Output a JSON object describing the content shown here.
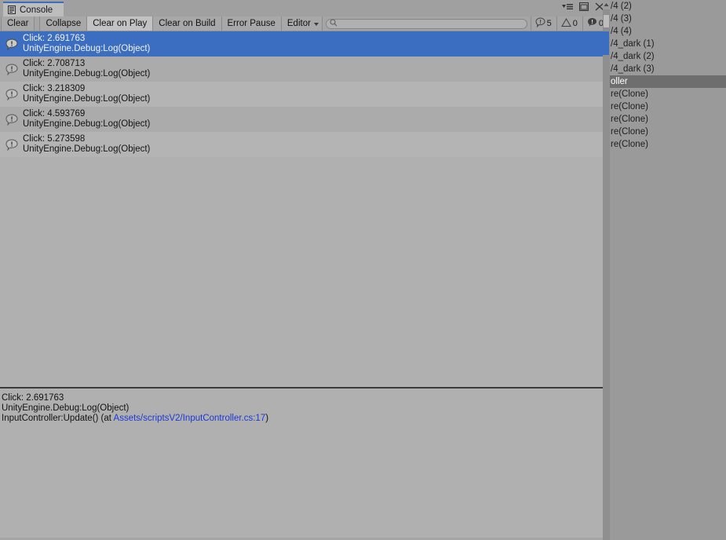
{
  "window": {
    "tab_label": "Console",
    "tab_icon": "console-icon",
    "controls": [
      {
        "name": "window-menu-icon",
        "label": "menu"
      },
      {
        "name": "maximize-icon",
        "label": "maximize"
      },
      {
        "name": "close-icon",
        "label": "close"
      }
    ]
  },
  "toolbar": {
    "clear_label": "Clear",
    "collapse_label": "Collapse",
    "clear_on_play_label": "Clear on Play",
    "clear_on_build_label": "Clear on Build",
    "error_pause_label": "Error Pause",
    "editor_label": "Editor",
    "search_value": "",
    "search_placeholder": "",
    "search_icon": "search-icon",
    "counters": {
      "info_icon": "info-log-icon",
      "info_count": "5",
      "warning_icon": "warning-triangle-icon",
      "warning_count": "0",
      "error_icon": "error-log-icon",
      "error_count": "0"
    }
  },
  "log_entries": [
    {
      "icon": "info-log-icon",
      "message": "Click: 2.691763",
      "source": "UnityEngine.Debug:Log(Object)",
      "selected": true
    },
    {
      "icon": "info-log-icon",
      "message": "Click: 2.708713",
      "source": "UnityEngine.Debug:Log(Object)",
      "selected": false
    },
    {
      "icon": "info-log-icon",
      "message": "Click: 3.218309",
      "source": "UnityEngine.Debug:Log(Object)",
      "selected": false
    },
    {
      "icon": "info-log-icon",
      "message": "Click: 4.593769",
      "source": "UnityEngine.Debug:Log(Object)",
      "selected": false
    },
    {
      "icon": "info-log-icon",
      "message": "Click: 5.273598",
      "source": "UnityEngine.Debug:Log(Object)",
      "selected": false
    }
  ],
  "detail": {
    "line1": "Click: 2.691763",
    "line2": "UnityEngine.Debug:Log(Object)",
    "line3_prefix": "InputController:Update() (at ",
    "line3_link": "Assets/scriptsV2/InputController.cs:17",
    "line3_suffix": ")"
  },
  "hierarchy": {
    "items": [
      {
        "label": "/4 (2)",
        "selected": false
      },
      {
        "label": "/4 (3)",
        "selected": false
      },
      {
        "label": "/4 (4)",
        "selected": false
      },
      {
        "label": "/4_dark (1)",
        "selected": false
      },
      {
        "label": "/4_dark (2)",
        "selected": false
      },
      {
        "label": "/4_dark (3)",
        "selected": false
      },
      {
        "label": "oller",
        "selected": true
      },
      {
        "label": "re(Clone)",
        "selected": false
      },
      {
        "label": "re(Clone)",
        "selected": false
      },
      {
        "label": "re(Clone)",
        "selected": false
      },
      {
        "label": "re(Clone)",
        "selected": false
      },
      {
        "label": "re(Clone)",
        "selected": false
      }
    ]
  },
  "colors": {
    "selection_blue": "#3b6ec0",
    "hierarchy_selection": "#6e6e6e",
    "link_blue": "#1a39d6",
    "panel_grey": "#b0b0b0",
    "chrome_grey": "#a5a5a5"
  }
}
